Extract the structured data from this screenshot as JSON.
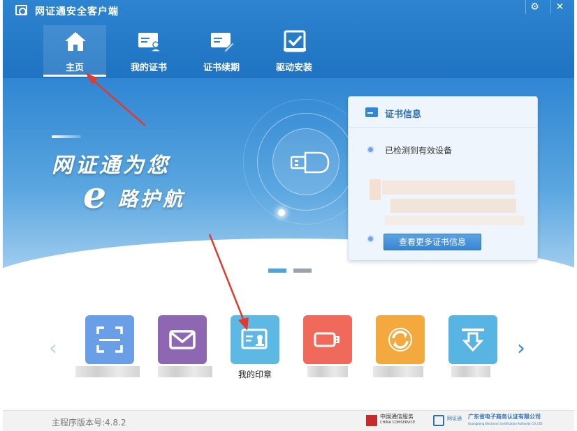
{
  "window": {
    "title": "网证通安全客户端",
    "settings_icon": "gear-icon",
    "close_icon": "close-icon"
  },
  "nav": {
    "items": [
      {
        "label": "主页",
        "icon": "home-icon",
        "active": true
      },
      {
        "label": "我的证书",
        "icon": "certificate-user-icon",
        "active": false
      },
      {
        "label": "证书续期",
        "icon": "certificate-pen-icon",
        "active": false
      },
      {
        "label": "驱动安装",
        "icon": "driver-install-icon",
        "active": false
      }
    ]
  },
  "banner": {
    "slogan_line1": "网证通为您",
    "slogan_e": "e",
    "slogan_line2": "路护航",
    "center_icon": "usb-key-icon"
  },
  "cert_card": {
    "title": "证书信息",
    "status": "已检测到有效设备",
    "more_button": "查看更多证书信息"
  },
  "pager": {
    "count": 2,
    "active_index": 0
  },
  "tiles": [
    {
      "icon": "scan-icon",
      "color": "#6a9ee6",
      "label": ""
    },
    {
      "icon": "mail-icon",
      "color": "#8e67b3",
      "label": ""
    },
    {
      "icon": "seal-certificate-icon",
      "color": "#5db9e3",
      "label": "我的印章"
    },
    {
      "icon": "usb-key-icon",
      "color": "#ef6a5a",
      "label": ""
    },
    {
      "icon": "sync-icon",
      "color": "#f3a93e",
      "label": ""
    },
    {
      "icon": "download-icon",
      "color": "#57b4e3",
      "label": ""
    }
  ],
  "carousel": {
    "prev_icon": "chevron-left-icon",
    "next_icon": "chevron-right-icon"
  },
  "footer": {
    "version": "主程序版本号:4.8.2",
    "logo_ct_line1": "中国通信服务",
    "logo_ct_line2": "CHINA COMSERVICE",
    "logo_wzt": "网证通",
    "logo_gd_line1": "广东省电子商务认证有限公司",
    "logo_gd_line2": "Guangdong Electronic Certification Authority CO.,LTD"
  },
  "colors": {
    "header_blue": "#1f73c2",
    "accent_blue": "#3a86d2",
    "annotation_red": "#e23b2e"
  }
}
